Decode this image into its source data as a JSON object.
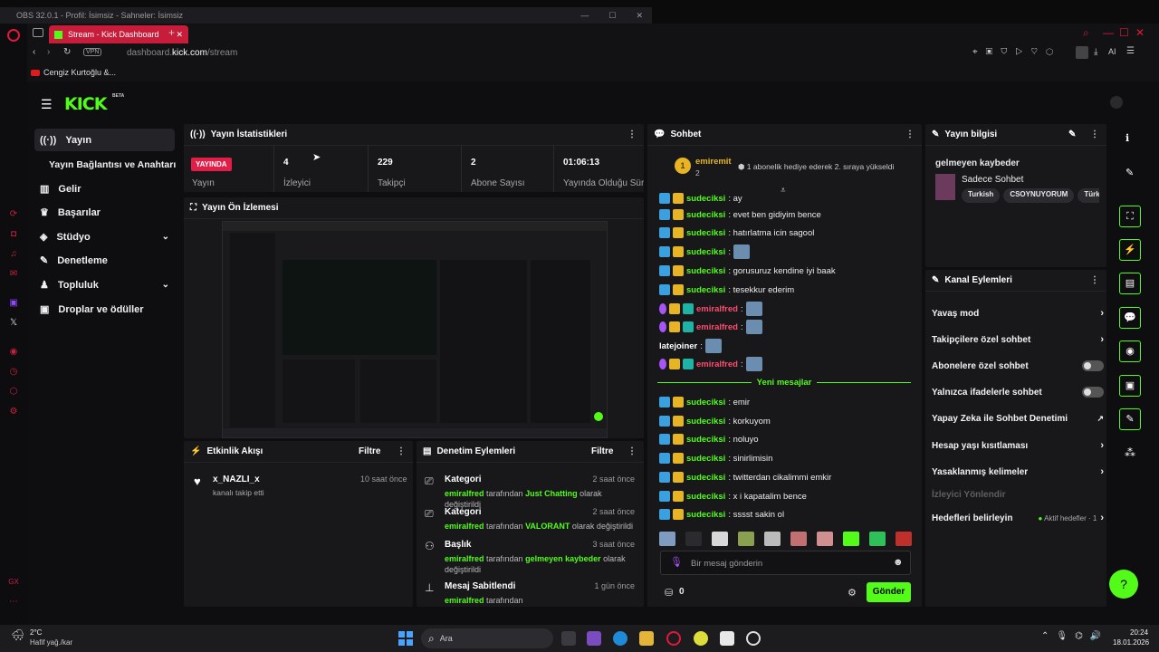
{
  "obs": {
    "title": "OBS 32.0.1 - Profil: İsimsiz - Sahneler: İsimsiz"
  },
  "browser": {
    "tab_title": "Stream - Kick Dashboard",
    "url_prefix": "dashboard.",
    "url_host": "kick.com",
    "url_path": "/stream",
    "vpn": "VPN",
    "bookmark": "Cengiz Kurtoğlu &...",
    "ai": "AI"
  },
  "brand": {
    "logo": "KICK",
    "beta": "BETA"
  },
  "nav": {
    "items": [
      {
        "label": "Yayın"
      },
      {
        "label": "Yayın Bağlantısı ve Anahtarı"
      },
      {
        "label": "Gelir"
      },
      {
        "label": "Başarılar"
      },
      {
        "label": "Stüdyo"
      },
      {
        "label": "Denetleme"
      },
      {
        "label": "Topluluk"
      },
      {
        "label": "Droplar ve ödüller"
      }
    ]
  },
  "stats": {
    "title": "Yayın İstatistikleri",
    "live_badge": "YAYINDA",
    "live_label": "Yayın",
    "items": [
      {
        "value": "4",
        "label": "İzleyici"
      },
      {
        "value": "229",
        "label": "Takipçi"
      },
      {
        "value": "2",
        "label": "Abone Sayısı"
      },
      {
        "value": "01:06:13",
        "label": "Yayında Olduğu Süre"
      }
    ]
  },
  "preview": {
    "title": "Yayın Ön İzlemesi"
  },
  "activity": {
    "title": "Etkinlik Akışı",
    "filter": "Filtre",
    "user": "x_NAZLI_x",
    "action": "kanalı takip etti",
    "time": "10 saat önce"
  },
  "modlog": {
    "title": "Denetim Eylemleri",
    "filter": "Filtre",
    "items": [
      {
        "title": "Kategori",
        "user": "emiralfred",
        "mid": " tarafından ",
        "value": "Just Chatting",
        "tail": " olarak değiştirildi",
        "time": "2 saat önce"
      },
      {
        "title": "Kategori",
        "user": "emiralfred",
        "mid": " tarafından ",
        "value": "VALORANT",
        "tail": " olarak değiştirildi",
        "time": "2 saat önce"
      },
      {
        "title": "Başlık",
        "user": "emiralfred",
        "mid": " tarafından ",
        "value": "gelmeyen kaybeder",
        "tail": " olarak değiştirildi",
        "time": "3 saat önce"
      },
      {
        "title": "Mesaj Sabitlendi",
        "user": "emiralfred",
        "mid": " tarafından",
        "value": "",
        "tail": "",
        "time": "1 gün önce"
      }
    ]
  },
  "chat": {
    "title": "Sohbet",
    "pinned_user": "emiremit",
    "pinned_count": "2",
    "pinned_rank": "1",
    "pinned_text": "1 abonelik hediye ederek 2. sıraya yükseldi",
    "lines": [
      {
        "user": "sudeciksi",
        "text": ": ay"
      },
      {
        "user": "sudeciksi",
        "text": ": evet ben gidiyim bence"
      },
      {
        "user": "sudeciksi",
        "text": ": hatırlatma icin sagool"
      },
      {
        "user": "sudeciksi",
        "text": ": "
      },
      {
        "user": "sudeciksi",
        "text": ": gorusuruz kendine iyi baak"
      },
      {
        "user": "sudeciksi",
        "text": ": tesekkur ederim"
      },
      {
        "user": "emiralfred",
        "text": ": "
      },
      {
        "user": "emiralfred",
        "text": ": "
      },
      {
        "user": "latejoiner",
        "text": ": "
      },
      {
        "user": "emiralfred",
        "text": ": "
      }
    ],
    "new_messages": "Yeni mesajlar",
    "new_lines": [
      {
        "user": "sudeciksi",
        "text": ": emir"
      },
      {
        "user": "sudeciksi",
        "text": ": korkuyom"
      },
      {
        "user": "sudeciksi",
        "text": ": noluyo"
      },
      {
        "user": "sudeciksi",
        "text": ": sinirlimisin"
      },
      {
        "user": "sudeciksi",
        "text": ": twitterdan cikalimmi emkir"
      },
      {
        "user": "sudeciksi",
        "text": ": x i kapatalim bence"
      },
      {
        "user": "sudeciksi",
        "text": ": sssst sakin ol"
      }
    ],
    "input_placeholder": "Bir mesaj gönderin",
    "points": "0",
    "send": "Gönder"
  },
  "info": {
    "title": "Yayın bilgisi",
    "stream_title": "gelmeyen kaybeder",
    "category": "Sadece Sohbet",
    "tags": [
      "Turkish",
      "CSOYNUYORUM",
      "Türkç"
    ]
  },
  "actions": {
    "title": "Kanal Eylemleri",
    "items": [
      {
        "label": "Yavaş mod"
      },
      {
        "label": "Takipçilere özel sohbet"
      },
      {
        "label": "Abonelere özel sohbet"
      },
      {
        "label": "Yalnızca ifadelerle sohbet"
      },
      {
        "label": "Yapay Zeka ile Sohbet Denetimi"
      },
      {
        "label": "Hesap yaşı kısıtlaması"
      },
      {
        "label": "Yasaklanmış kelimeler"
      },
      {
        "label": "İzleyici Yönlendir"
      },
      {
        "label": "Hedefleri belirleyin"
      }
    ],
    "goals_status": "Aktif hedefler · 1"
  },
  "taskbar": {
    "weather_temp": "2°C",
    "weather_desc": "Hafif yağ./kar",
    "search": "Ara",
    "time": "20:24",
    "date": "18.01.2026"
  },
  "colors": {
    "accent": "#53fc18",
    "live": "#e11d48",
    "panel": "#18181b"
  }
}
